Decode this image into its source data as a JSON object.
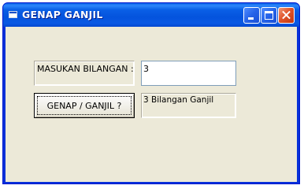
{
  "window": {
    "title": "GENAP GANJIL",
    "icon": "app-window-icon",
    "controls": {
      "minimize_icon": "minimize-icon",
      "maximize_icon": "maximize-icon",
      "close_icon": "close-icon"
    }
  },
  "form": {
    "prompt_label": "MASUKAN BILANGAN :",
    "number_input": {
      "value": "3"
    },
    "check_button_label": "GENAP / GANJIL ?",
    "result_text": "3 Bilangan Ganjil"
  },
  "colors": {
    "titlebar": "#0a5fe6",
    "client_background": "#ece9d8",
    "close_button": "#e1542a"
  }
}
